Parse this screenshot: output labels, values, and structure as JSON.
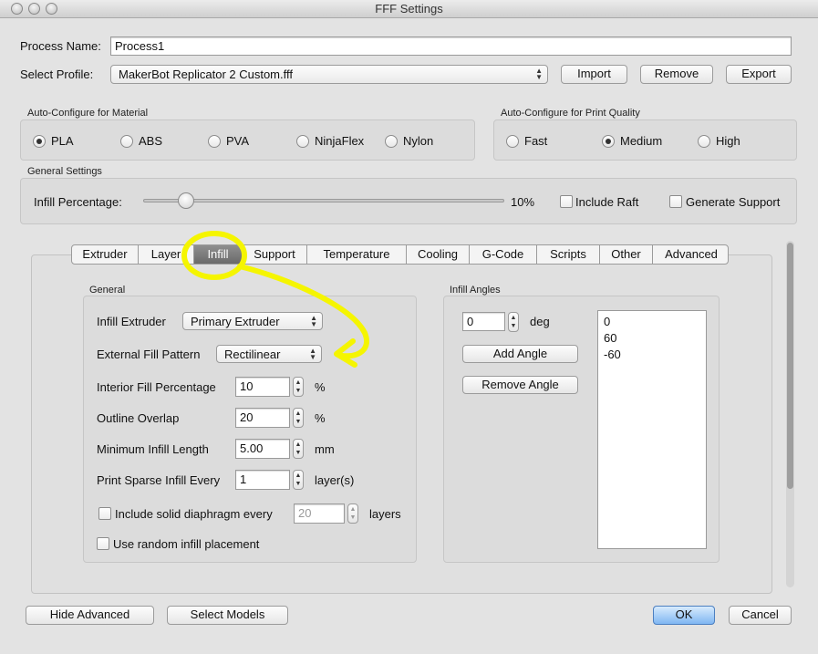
{
  "window": {
    "title": "FFF Settings"
  },
  "process": {
    "name_label": "Process Name:",
    "name_value": "Process1"
  },
  "profile": {
    "label": "Select Profile:",
    "value": "MakerBot Replicator 2 Custom.fff",
    "import_label": "Import",
    "remove_label": "Remove",
    "export_label": "Export"
  },
  "material": {
    "title": "Auto-Configure for Material",
    "options": [
      "PLA",
      "ABS",
      "PVA",
      "NinjaFlex",
      "Nylon"
    ],
    "selected": "PLA"
  },
  "quality": {
    "title": "Auto-Configure for Print Quality",
    "options": [
      "Fast",
      "Medium",
      "High"
    ],
    "selected": "Medium"
  },
  "general_settings": {
    "title": "General Settings",
    "infill_label": "Infill Percentage:",
    "infill_value": "10%",
    "infill_fraction": 0.1,
    "raft_label": "Include Raft",
    "support_label": "Generate Support"
  },
  "tabs": [
    "Extruder",
    "Layer",
    "Infill",
    "Support",
    "Temperature",
    "Cooling",
    "G-Code",
    "Scripts",
    "Other",
    "Advanced"
  ],
  "selected_tab": "Infill",
  "general": {
    "title": "General",
    "infill_extruder_label": "Infill Extruder",
    "infill_extruder_value": "Primary Extruder",
    "external_fill_label": "External Fill Pattern",
    "external_fill_value": "Rectilinear",
    "interior_fill_label": "Interior Fill Percentage",
    "interior_fill_value": "10",
    "interior_fill_unit": "%",
    "outline_overlap_label": "Outline Overlap",
    "outline_overlap_value": "20",
    "outline_overlap_unit": "%",
    "min_infill_label": "Minimum Infill Length",
    "min_infill_value": "5.00",
    "min_infill_unit": "mm",
    "sparse_label": "Print Sparse Infill Every",
    "sparse_value": "1",
    "sparse_unit": "layer(s)",
    "diaphragm_label": "Include solid diaphragm every",
    "diaphragm_value": "20",
    "diaphragm_unit": "layers",
    "random_label": "Use random infill placement"
  },
  "angles": {
    "title": "Infill Angles",
    "input_value": "0",
    "unit": "deg",
    "add_label": "Add Angle",
    "remove_label": "Remove Angle",
    "list": [
      "0",
      "60",
      "-60"
    ]
  },
  "footer": {
    "hide_advanced_label": "Hide Advanced",
    "select_models_label": "Select Models",
    "ok_label": "OK",
    "cancel_label": "Cancel"
  },
  "colors": {
    "annotation": "#f5f500",
    "ok_button": "#7fb6f2",
    "selected_tab": "#7a7a7a"
  }
}
